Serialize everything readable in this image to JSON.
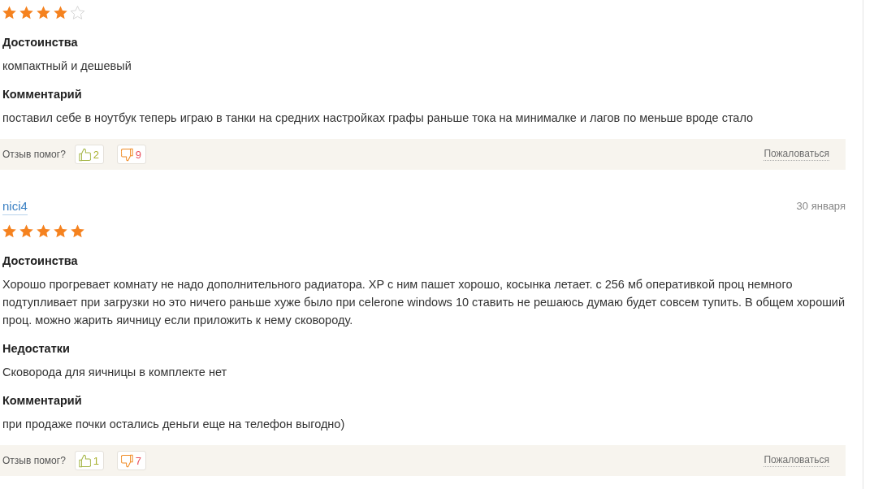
{
  "reviews": [
    {
      "stars": 4,
      "sections": [
        {
          "heading": "Достоинства",
          "text": "компактный и дешевый"
        },
        {
          "heading": "Комментарий",
          "text": "поставил себе в ноутбук теперь играю в танки на средних настройках графы раньше тока на минималке и лагов по меньше вроде стало"
        }
      ],
      "feedback": {
        "question": "Отзыв помог?",
        "likes": "2",
        "dislikes": "9",
        "report": "Пожаловаться"
      }
    },
    {
      "author": "nici4",
      "date": "30 января",
      "stars": 5,
      "sections": [
        {
          "heading": "Достоинства",
          "text": "Хорошо прогревает комнату не надо дополнительного радиатора. XP с ним пашет хорошо, косынка летает. с 256 мб оперативкой проц немного подтупливает при загрузки но это ничего раньше хуже было при celerone windows 10 ставить не решаюсь думаю будет совсем тупить. В общем хороший проц. можно жарить яичницу если приложить к нему сковороду."
        },
        {
          "heading": "Недостатки",
          "text": "Сковорода для яичницы в комплекте нет"
        },
        {
          "heading": "Комментарий",
          "text": "при продаже почки остались деньги еще на телефон выгодно)"
        }
      ],
      "feedback": {
        "question": "Отзыв помог?",
        "likes": "1",
        "dislikes": "7",
        "report": "Пожаловаться"
      }
    }
  ]
}
